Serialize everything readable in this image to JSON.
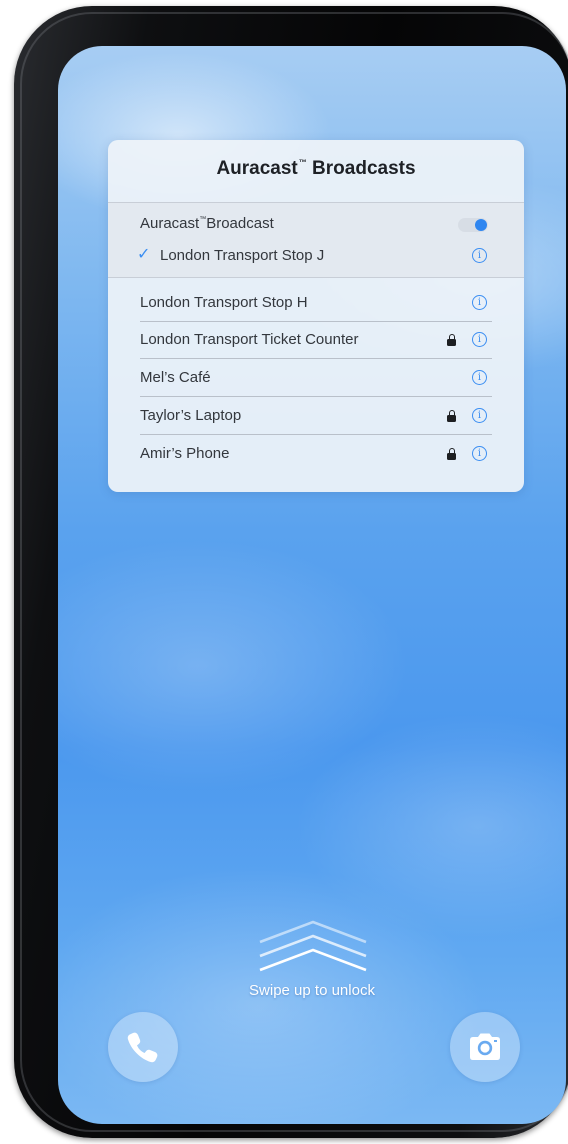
{
  "panel": {
    "title": "Auracast",
    "title_mark": "™",
    "title_suffix": " Broadcasts",
    "toggle_row": {
      "label": "Auracast",
      "mark": "™",
      "suffix": "Broadcast",
      "enabled": true
    },
    "selected": {
      "label": "London Transport Stop J",
      "icon": "checkmark-icon"
    },
    "broadcasts": [
      {
        "label": "London Transport Stop H",
        "locked": false
      },
      {
        "label": "London Transport Ticket Counter",
        "locked": true
      },
      {
        "label": "Mel’s Café",
        "locked": false
      },
      {
        "label": "Taylor’s Laptop",
        "locked": true
      },
      {
        "label": "Amir’s Phone",
        "locked": true
      }
    ]
  },
  "lockscreen": {
    "swipe_text": "Swipe up to unlock",
    "left_button_icon": "phone-icon",
    "right_button_icon": "camera-icon"
  },
  "colors": {
    "accent": "#3b8ef2",
    "panel_bg": "#eef3f9",
    "wallpaper": "#4b98ee"
  }
}
